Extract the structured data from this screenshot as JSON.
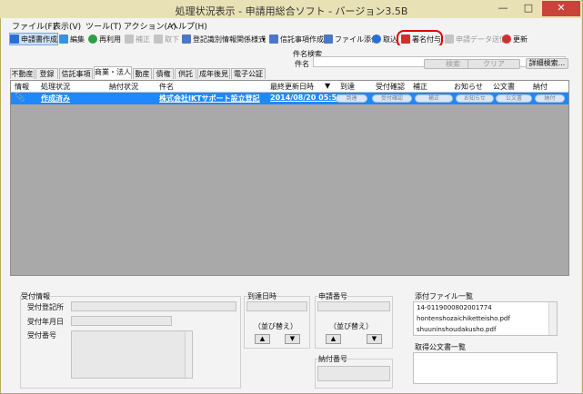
{
  "window": {
    "title": "処理状況表示 - 申請用総合ソフト - バージョン3.5B",
    "minimize": "—",
    "maximize": "□",
    "close": "✕"
  },
  "menu": [
    "ファイル(F)",
    "表示(V)",
    "ツール(T)",
    "アクション(A)",
    "ヘルプ(H)"
  ],
  "toolbar": {
    "items": [
      {
        "label": "申請書作成",
        "icon": "document-create-icon",
        "color": "#2a6fd6"
      },
      {
        "label": "編集",
        "icon": "edit-icon",
        "color": "#3c8fe0"
      },
      {
        "label": "再利用",
        "icon": "recycle-icon",
        "color": "#2ea043"
      },
      {
        "label": "補正",
        "icon": "correction-icon",
        "color": "#b0b0b0"
      },
      {
        "label": "取下",
        "icon": "withdraw-icon",
        "color": "#b0b0b0"
      },
      {
        "label": "登記識別情報関係様式",
        "icon": "form-icon",
        "color": "#4a78c8"
      },
      {
        "label": "▾",
        "icon": "",
        "color": ""
      },
      {
        "label": "信託事項作成",
        "icon": "trust-icon",
        "color": "#4a78c8"
      },
      {
        "label": "ファイル添付",
        "icon": "attach-icon",
        "color": "#4a78c8"
      },
      {
        "label": "取込",
        "icon": "import-icon",
        "color": "#2a6fd6"
      },
      {
        "label": "署名付与",
        "icon": "signature-icon",
        "color": "#d03030"
      },
      {
        "label": "申請データ送信",
        "icon": "send-icon",
        "color": "#b0b0b0"
      },
      {
        "label": "更新",
        "icon": "refresh-icon",
        "color": "#d03030"
      }
    ]
  },
  "search": {
    "group_label": "件名検索",
    "field_label": "件名",
    "value": "",
    "search_button": "検索",
    "clear_button": "クリア",
    "detail_button": "詳細検索..."
  },
  "tabs": [
    "不動産",
    "登録",
    "信託事項",
    "商業・法人",
    "動産",
    "債権",
    "供託",
    "成年後見",
    "電子公証"
  ],
  "active_tab": "商業・法人",
  "table": {
    "columns": [
      "情報",
      "処理状況",
      "納付状況",
      "件名",
      "最終更新日時",
      "到達",
      "受付確認",
      "補正",
      "お知らせ",
      "公文書",
      "納付"
    ],
    "sort_indicator": "▼",
    "rows": [
      {
        "info_icon": "paperclip-icon",
        "status": "作成済み",
        "payment": "",
        "subject": "株式会社IKTサポート設立登記",
        "updated": "2014/08/20 05:51",
        "buttons": [
          "到達",
          "受付確認",
          "補正",
          "お知らせ",
          "公文書",
          "納付"
        ]
      }
    ]
  },
  "receipt": {
    "title": "受付情報",
    "office_label": "受付登記所",
    "date_label": "受付年月日",
    "number_label": "受付番号"
  },
  "arrival": {
    "title": "到達日時",
    "sort_label": "（並び替え）",
    "up": "▲",
    "down": "▼"
  },
  "application": {
    "title": "申請番号",
    "sort_label": "（並び替え）",
    "up": "▲",
    "down": "▼"
  },
  "payment_number": {
    "title": "納付番号"
  },
  "attachments": {
    "title": "添付ファイル一覧",
    "items": [
      "14-0119000802001774",
      "hontenshozaichiketteisho.pdf",
      "shuuninshoudakusho.pdf"
    ]
  },
  "official_docs": {
    "title": "取得公文書一覧"
  }
}
